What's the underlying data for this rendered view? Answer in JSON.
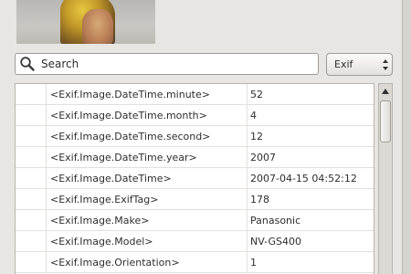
{
  "search": {
    "placeholder": "Search",
    "icon": "magnifier-icon"
  },
  "filter": {
    "selected": "Exif"
  },
  "table": {
    "rows": [
      {
        "key": "<Exif.Image.DateTime.minute>",
        "value": "52"
      },
      {
        "key": "<Exif.Image.DateTime.month>",
        "value": "4"
      },
      {
        "key": "<Exif.Image.DateTime.second>",
        "value": "12"
      },
      {
        "key": "<Exif.Image.DateTime.year>",
        "value": "2007"
      },
      {
        "key": "<Exif.Image.DateTime>",
        "value": "2007-04-15 04:52:12"
      },
      {
        "key": "<Exif.Image.ExifTag>",
        "value": "178"
      },
      {
        "key": "<Exif.Image.Make>",
        "value": "Panasonic"
      },
      {
        "key": "<Exif.Image.Model>",
        "value": "NV-GS400"
      },
      {
        "key": "<Exif.Image.Orientation>",
        "value": "1"
      }
    ]
  }
}
